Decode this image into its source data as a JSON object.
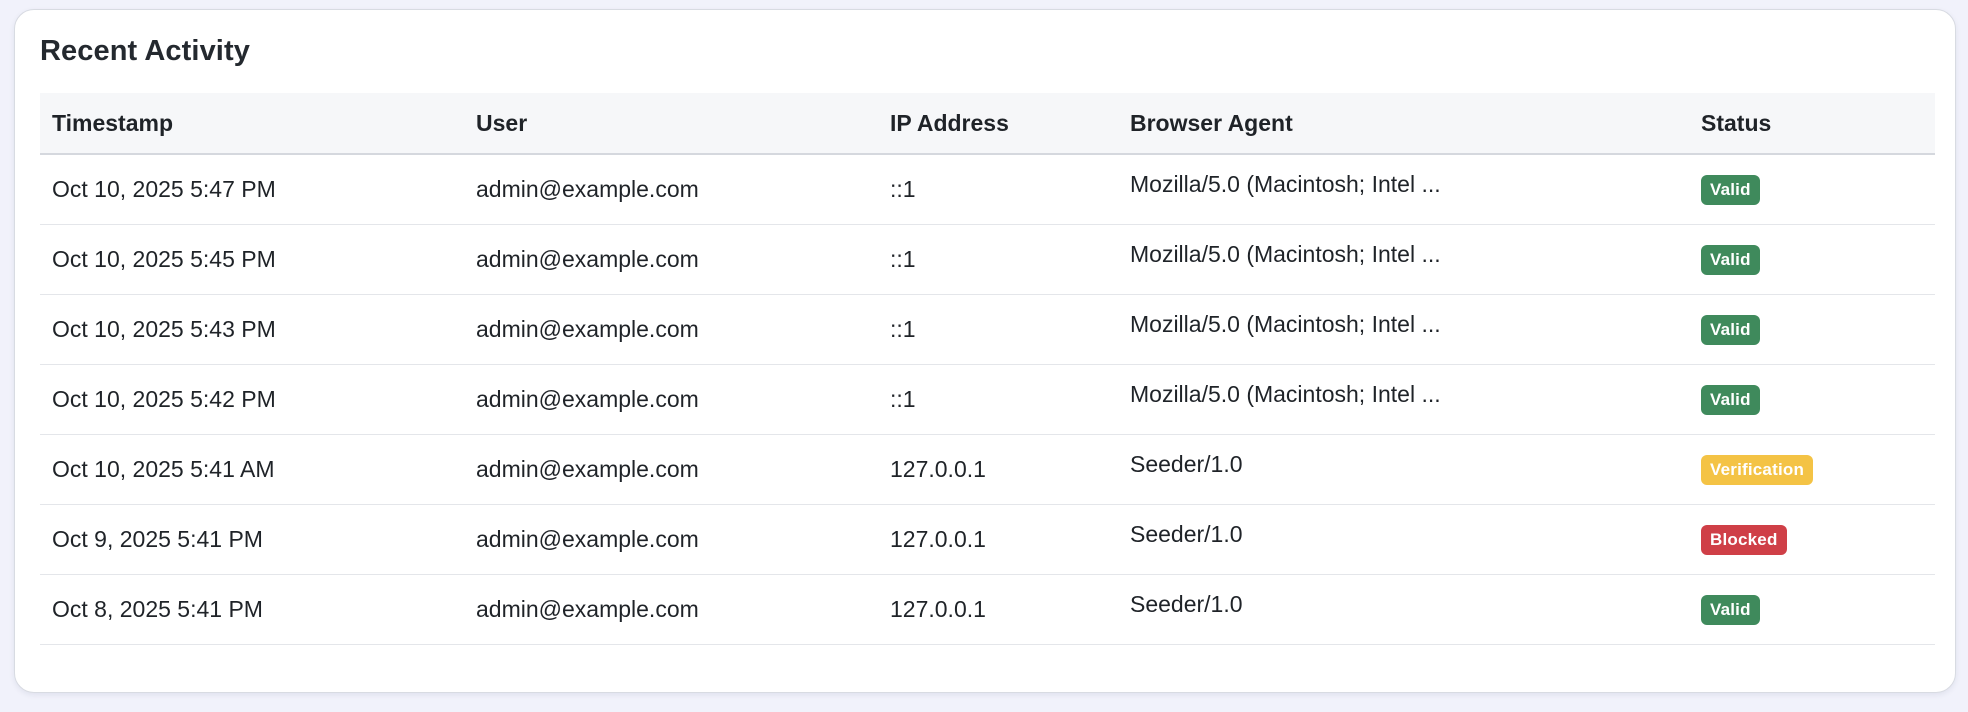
{
  "card": {
    "title": "Recent Activity"
  },
  "table": {
    "columns": [
      "Timestamp",
      "User",
      "IP Address",
      "Browser Agent",
      "Status"
    ],
    "rows": [
      {
        "timestamp": "Oct 10, 2025 5:47 PM",
        "user": "admin@example.com",
        "ip": "::1",
        "agent": "Mozilla/5.0 (Macintosh; Intel ...",
        "status": "Valid",
        "status_kind": "valid"
      },
      {
        "timestamp": "Oct 10, 2025 5:45 PM",
        "user": "admin@example.com",
        "ip": "::1",
        "agent": "Mozilla/5.0 (Macintosh; Intel ...",
        "status": "Valid",
        "status_kind": "valid"
      },
      {
        "timestamp": "Oct 10, 2025 5:43 PM",
        "user": "admin@example.com",
        "ip": "::1",
        "agent": "Mozilla/5.0 (Macintosh; Intel ...",
        "status": "Valid",
        "status_kind": "valid"
      },
      {
        "timestamp": "Oct 10, 2025 5:42 PM",
        "user": "admin@example.com",
        "ip": "::1",
        "agent": "Mozilla/5.0 (Macintosh; Intel ...",
        "status": "Valid",
        "status_kind": "valid"
      },
      {
        "timestamp": "Oct 10, 2025 5:41 AM",
        "user": "admin@example.com",
        "ip": "127.0.0.1",
        "agent": "Seeder/1.0",
        "status": "Verification",
        "status_kind": "verification"
      },
      {
        "timestamp": "Oct 9, 2025 5:41 PM",
        "user": "admin@example.com",
        "ip": "127.0.0.1",
        "agent": "Seeder/1.0",
        "status": "Blocked",
        "status_kind": "blocked"
      },
      {
        "timestamp": "Oct 8, 2025 5:41 PM",
        "user": "admin@example.com",
        "ip": "127.0.0.1",
        "agent": "Seeder/1.0",
        "status": "Valid",
        "status_kind": "valid"
      }
    ]
  },
  "colors": {
    "valid": "#3f8a5c",
    "verification": "#f4c345",
    "blocked": "#cf3f47"
  }
}
